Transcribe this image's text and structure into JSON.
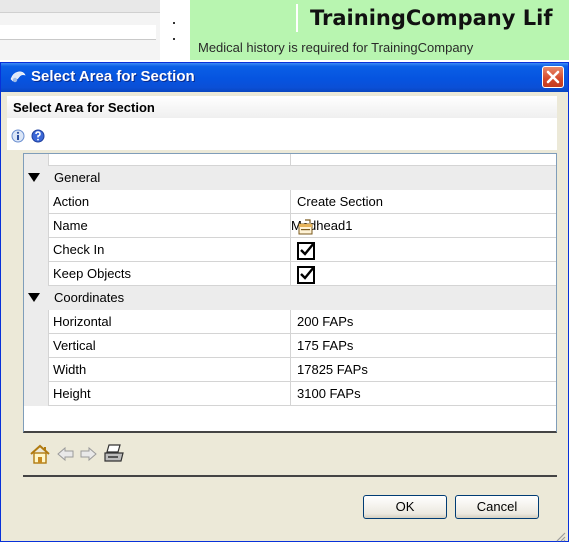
{
  "background": {
    "title": "TrainingCompany Lif",
    "subtitle": "Medical history is required for TrainingCompany"
  },
  "dialog": {
    "title": "Select Area for Section",
    "close_icon": "close-icon",
    "header_title": "Select Area for Section",
    "header_icons": [
      "info-icon",
      "help-icon"
    ],
    "categories": {
      "general": "General",
      "coordinates": "Coordinates"
    },
    "properties": {
      "action": {
        "label": "Action",
        "value": "Create Section"
      },
      "name": {
        "label": "Name",
        "value": "Medhead1"
      },
      "check_in": {
        "label": "Check In",
        "checked": true
      },
      "keep_objects": {
        "label": "Keep Objects",
        "checked": true
      },
      "horizontal": {
        "label": "Horizontal",
        "value": "200 FAPs"
      },
      "vertical": {
        "label": "Vertical",
        "value": "175 FAPs"
      },
      "width": {
        "label": "Width",
        "value": "17825 FAPs"
      },
      "height": {
        "label": "Height",
        "value": "3100 FAPs"
      }
    },
    "toolbar_icons": [
      "home-icon",
      "back-arrow-icon",
      "forward-arrow-icon",
      "print-icon"
    ],
    "ok_label": "OK",
    "cancel_label": "Cancel"
  },
  "colors": {
    "titlebar_blue": "#0654e0",
    "background_green": "#b8f5b0",
    "dialog_face": "#ece9d8",
    "close_red": "#d4482a"
  }
}
